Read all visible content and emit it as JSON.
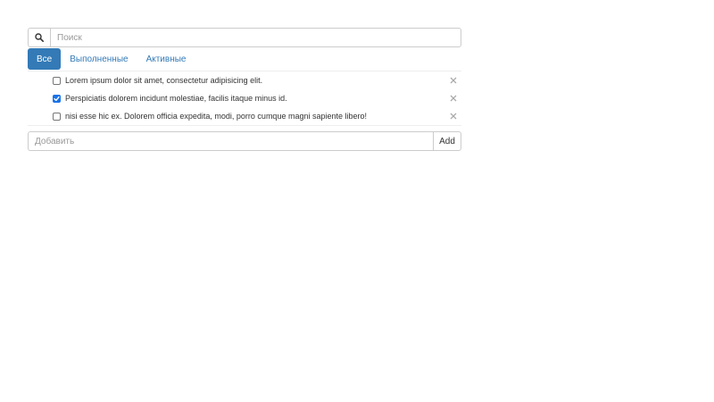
{
  "search": {
    "placeholder": "Поиск",
    "value": "",
    "icon": "search-icon"
  },
  "tabs": [
    {
      "label": "Все",
      "active": true
    },
    {
      "label": "Выполненные",
      "active": false
    },
    {
      "label": "Активные",
      "active": false
    }
  ],
  "todos": [
    {
      "text": "Lorem ipsum dolor sit amet, consectetur adipisicing elit.",
      "done": false
    },
    {
      "text": "Perspiciatis dolorem incidunt molestiae, facilis itaque minus id.",
      "done": true
    },
    {
      "text": "nisi esse hic ex. Dolorem officia expedita, modi, porro cumque magni sapiente libero!",
      "done": false
    }
  ],
  "add": {
    "placeholder": "Добавить",
    "value": "",
    "button_label": "Add"
  },
  "colors": {
    "accent": "#337ab7",
    "checkbox": "#1a73e8",
    "remove_icon": "#aaaaaa"
  }
}
